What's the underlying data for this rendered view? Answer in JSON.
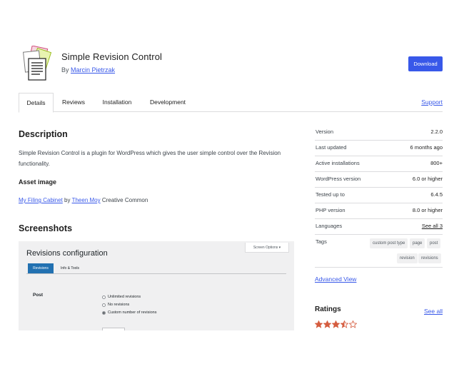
{
  "plugin": {
    "title": "Simple Revision Control",
    "by_prefix": "By",
    "author": "Marcin Pietrzak",
    "download_label": "Download"
  },
  "tabs": [
    {
      "label": "Details",
      "active": true
    },
    {
      "label": "Reviews",
      "active": false
    },
    {
      "label": "Installation",
      "active": false
    },
    {
      "label": "Development",
      "active": false
    }
  ],
  "support_label": "Support",
  "description": {
    "heading": "Description",
    "text": "Simple Revision Control is a plugin for WordPress which gives the user simple control over the Revision functionality.",
    "asset_heading": "Asset image",
    "asset_link1": "My Filing Cabinet",
    "asset_by": "by",
    "asset_link2": "Theen Moy",
    "asset_suffix": "Creative Common"
  },
  "screenshots": {
    "heading": "Screenshots",
    "ss_title": "Revisions configuration",
    "ss_screen_options": "Screen Options ▾",
    "ss_tab_active": "Revisions",
    "ss_tab_inactive": "Info & Tools",
    "ss_post_label": "Post",
    "ss_options": [
      "Unlimited revisions",
      "No revisions",
      "Custom number of revisions"
    ]
  },
  "meta": {
    "rows": [
      {
        "key": "Version",
        "value": "2.2.0"
      },
      {
        "key": "Last updated",
        "value": "6 months ago"
      },
      {
        "key": "Active installations",
        "value": "800+"
      },
      {
        "key": "WordPress version",
        "value": "6.0 or higher"
      },
      {
        "key": "Tested up to",
        "value": "6.4.5"
      },
      {
        "key": "PHP version",
        "value": "8.0 or higher"
      },
      {
        "key": "Languages",
        "value": "See all 3"
      }
    ],
    "tags_label": "Tags",
    "tags": [
      "custom post type",
      "page",
      "post",
      "revision",
      "revisions"
    ]
  },
  "advanced_view": "Advanced View",
  "ratings": {
    "heading": "Ratings",
    "see_all": "See all",
    "stars": 3.5,
    "max": 5,
    "star_color": "#d55c3f"
  },
  "colors": {
    "accent": "#3858e9",
    "wp_blue": "#2271b1"
  }
}
